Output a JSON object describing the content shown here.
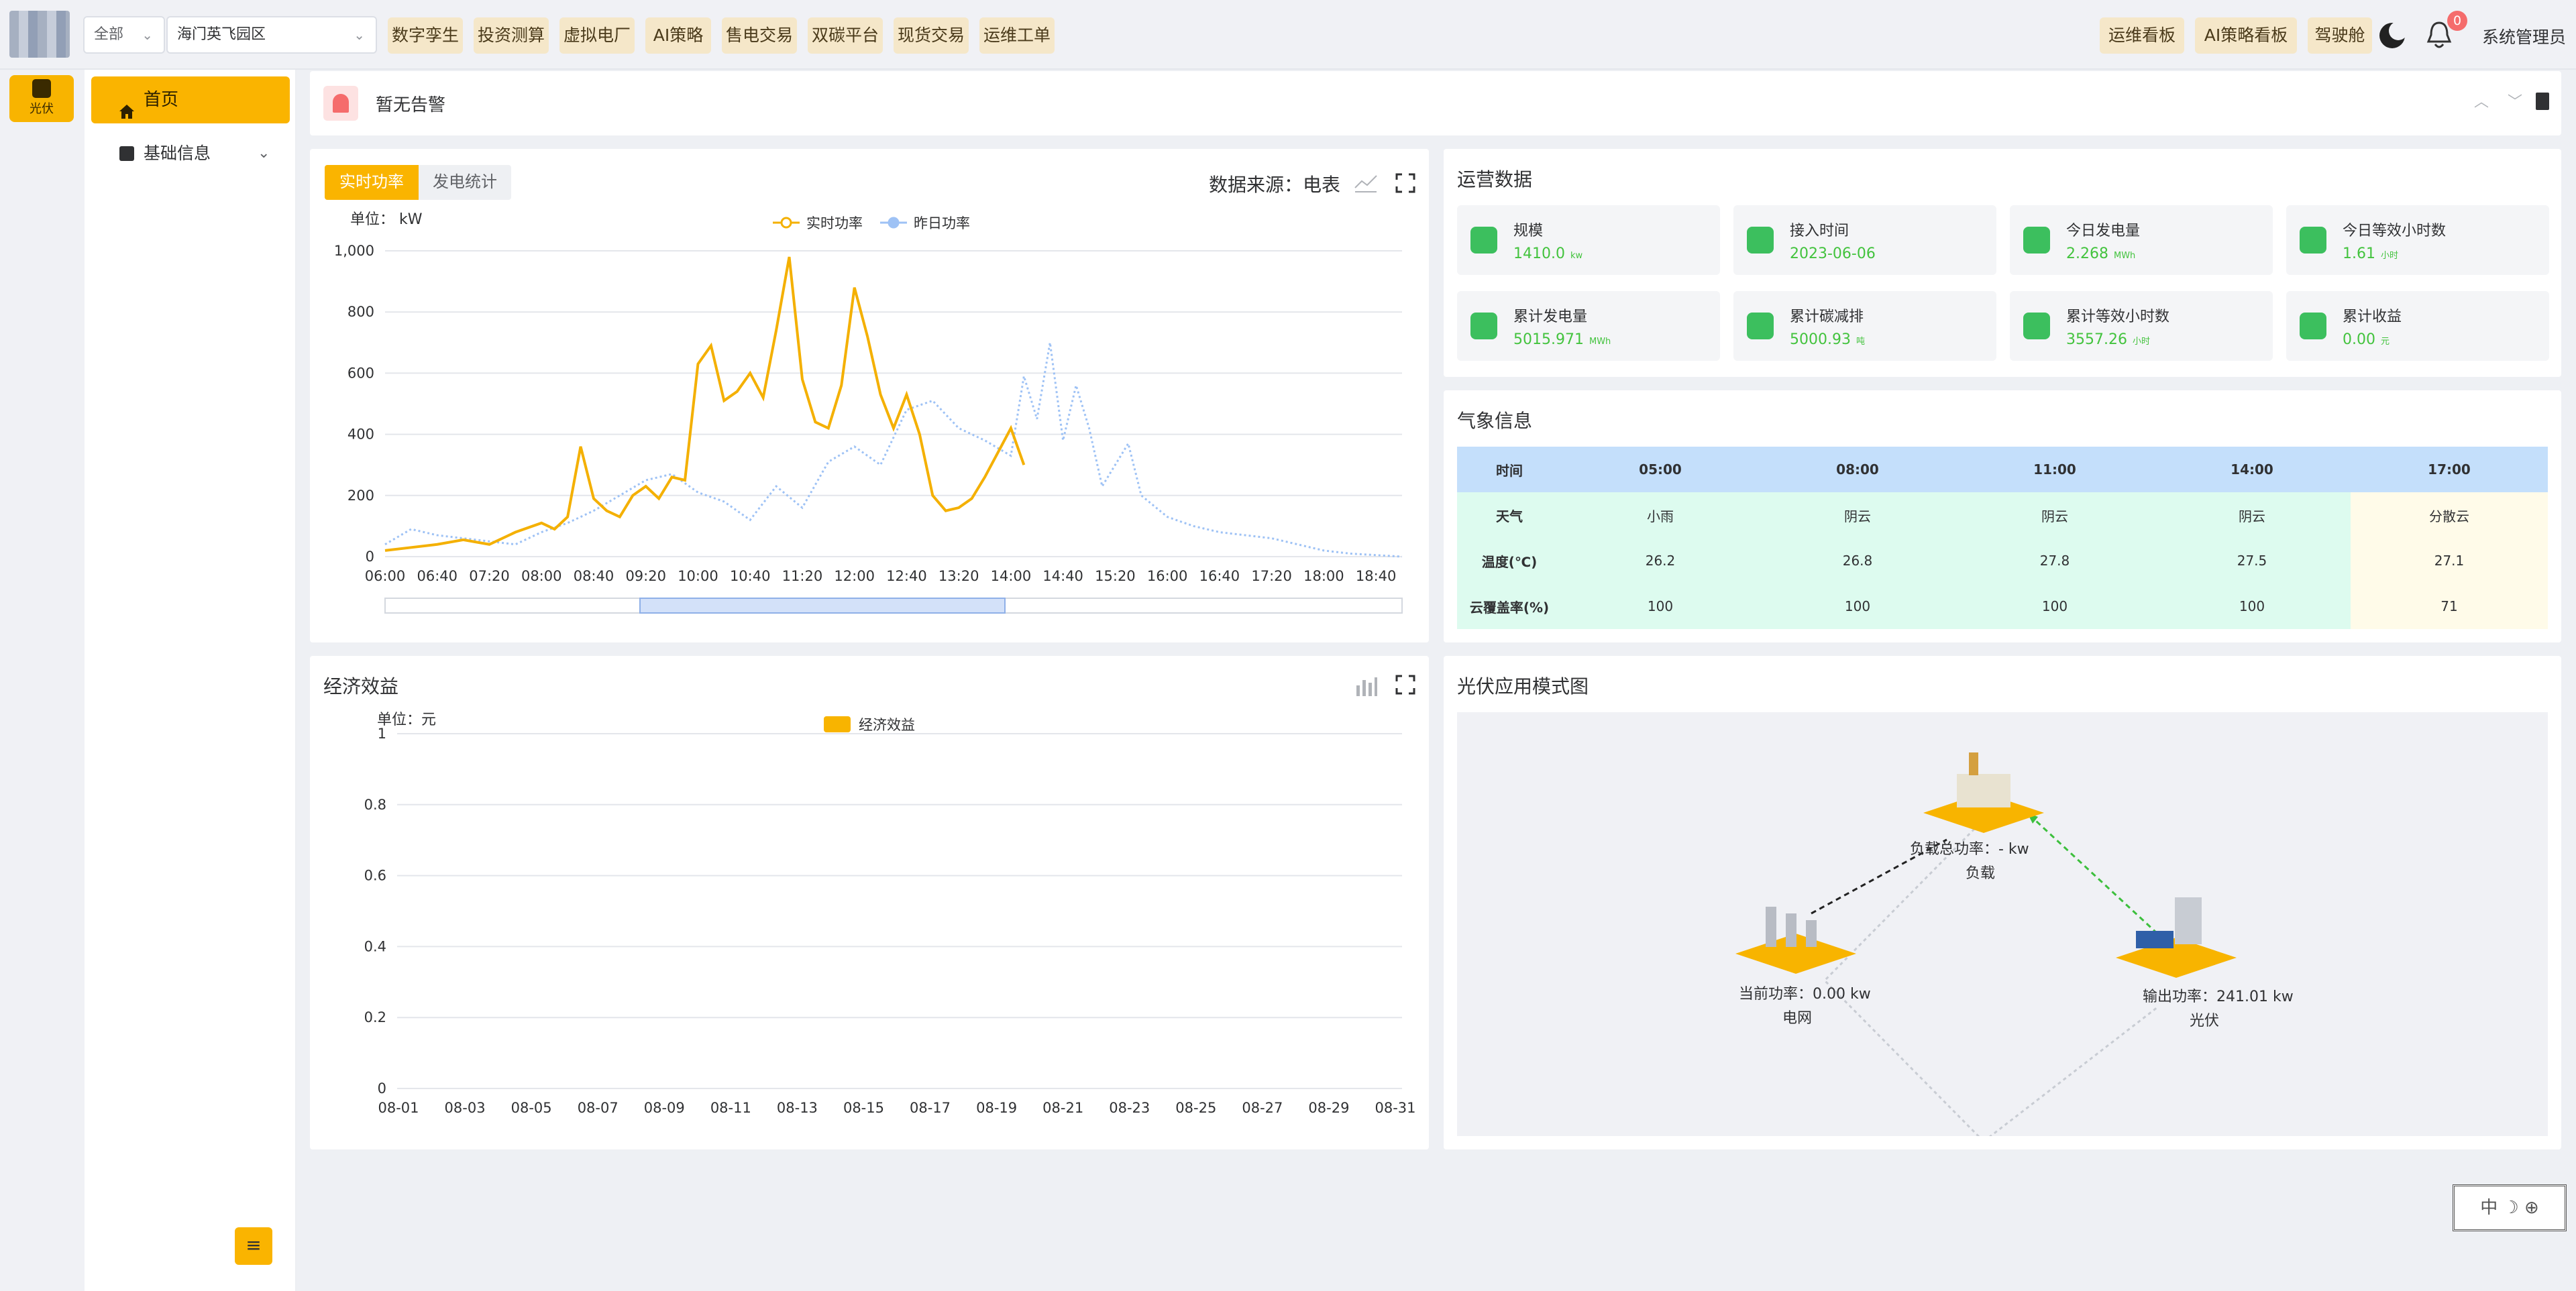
{
  "topbar": {
    "scope_select": "全部",
    "park_select": "海门英飞园区",
    "nav": [
      "数字孪生",
      "投资测算",
      "虚拟电厂",
      "AI策略",
      "售电交易",
      "双碳平台",
      "现货交易",
      "运维工单"
    ],
    "right_nav": [
      "运维看板",
      "AI策略看板",
      "驾驶舱"
    ],
    "notification_count": "0",
    "user": "系统管理员"
  },
  "rail": {
    "pv_label": "光伏"
  },
  "menu": {
    "home": "首页",
    "basic": "基础信息"
  },
  "alarm": {
    "text": "暂无告警"
  },
  "power_card": {
    "tab_active": "实时功率",
    "tab_other": "发电统计",
    "source_label": "数据来源：",
    "source_value": "电表",
    "unit": "单位： kW"
  },
  "chart_data": [
    {
      "type": "line",
      "title": "",
      "ylabel": "单位： kW",
      "ylim": [
        0,
        1000
      ],
      "yticks": [
        "0",
        "200",
        "400",
        "600",
        "800",
        "1,000"
      ],
      "x_ticks": [
        "06:00",
        "06:40",
        "07:20",
        "08:00",
        "08:40",
        "09:20",
        "10:00",
        "10:40",
        "11:20",
        "12:00",
        "12:40",
        "13:20",
        "14:00",
        "14:40",
        "15:20",
        "16:00",
        "16:40",
        "17:20",
        "18:00",
        "18:40"
      ],
      "legend_position": "top",
      "series": [
        {
          "name": "实时功率",
          "color": "#f4b000",
          "style": "solid",
          "x": [
            "06:00",
            "06:20",
            "06:40",
            "07:00",
            "07:20",
            "07:40",
            "08:00",
            "08:10",
            "08:20",
            "08:30",
            "08:40",
            "08:50",
            "09:00",
            "09:10",
            "09:20",
            "09:30",
            "09:40",
            "09:50",
            "10:00",
            "10:10",
            "10:20",
            "10:30",
            "10:40",
            "10:50",
            "11:00",
            "11:10",
            "11:20",
            "11:30",
            "11:40",
            "11:50",
            "12:00",
            "12:10",
            "12:20",
            "12:30",
            "12:40",
            "12:50",
            "13:00",
            "13:10",
            "13:20",
            "13:30",
            "13:40",
            "13:50",
            "14:00",
            "14:10"
          ],
          "values": [
            20,
            30,
            40,
            55,
            40,
            80,
            110,
            90,
            130,
            360,
            190,
            150,
            130,
            200,
            230,
            190,
            260,
            250,
            630,
            690,
            510,
            540,
            600,
            520,
            740,
            980,
            580,
            440,
            420,
            560,
            880,
            720,
            530,
            420,
            530,
            400,
            200,
            150,
            160,
            190,
            260,
            340,
            420,
            300
          ]
        },
        {
          "name": "昨日功率",
          "color": "#9ec2f5",
          "style": "dotted",
          "x": [
            "06:00",
            "06:20",
            "06:40",
            "07:00",
            "07:20",
            "07:40",
            "08:00",
            "08:20",
            "08:40",
            "09:00",
            "09:20",
            "09:40",
            "10:00",
            "10:20",
            "10:40",
            "11:00",
            "11:20",
            "11:40",
            "12:00",
            "12:20",
            "12:40",
            "13:00",
            "13:20",
            "13:40",
            "14:00",
            "14:10",
            "14:20",
            "14:30",
            "14:40",
            "14:50",
            "15:00",
            "15:10",
            "15:20",
            "15:30",
            "15:40",
            "16:00",
            "16:20",
            "16:40",
            "17:00",
            "17:20",
            "17:40",
            "18:00",
            "18:20",
            "18:40",
            "19:00"
          ],
          "values": [
            40,
            90,
            70,
            60,
            50,
            40,
            80,
            110,
            150,
            200,
            250,
            270,
            210,
            180,
            120,
            230,
            160,
            310,
            360,
            300,
            480,
            510,
            420,
            380,
            330,
            590,
            450,
            700,
            380,
            560,
            420,
            230,
            300,
            370,
            200,
            130,
            100,
            80,
            70,
            60,
            40,
            20,
            10,
            5,
            0
          ]
        }
      ]
    },
    {
      "type": "bar",
      "title": "",
      "ylabel": "单位：元",
      "ylim": [
        0,
        1
      ],
      "yticks": [
        "0",
        "0.2",
        "0.4",
        "0.6",
        "0.8",
        "1"
      ],
      "categories": [
        "08-01",
        "08-03",
        "08-05",
        "08-07",
        "08-09",
        "08-11",
        "08-13",
        "08-15",
        "08-17",
        "08-19",
        "08-21",
        "08-23",
        "08-25",
        "08-27",
        "08-29",
        "08-31"
      ],
      "legend_position": "top",
      "series": [
        {
          "name": "经济效益",
          "color": "#f8b400",
          "values": []
        }
      ]
    }
  ],
  "ops": {
    "title": "运营数据",
    "stats": [
      {
        "label": "规模",
        "value": "1410.0",
        "unit": "kw"
      },
      {
        "label": "接入时间",
        "value": "2023-06-06",
        "unit": ""
      },
      {
        "label": "今日发电量",
        "value": "2.268",
        "unit": "MWh"
      },
      {
        "label": "今日等效小时数",
        "value": "1.61",
        "unit": "小时"
      },
      {
        "label": "累计发电量",
        "value": "5015.971",
        "unit": "MWh"
      },
      {
        "label": "累计碳减排",
        "value": "5000.93",
        "unit": "吨"
      },
      {
        "label": "累计等效小时数",
        "value": "3557.26",
        "unit": "小时"
      },
      {
        "label": "累计收益",
        "value": "0.00",
        "unit": "元"
      }
    ]
  },
  "weather": {
    "title": "气象信息",
    "header": [
      "时间",
      "05:00",
      "08:00",
      "11:00",
      "14:00",
      "17:00"
    ],
    "rows": [
      [
        "天气",
        "小雨",
        "阴云",
        "阴云",
        "阴云",
        "分散云"
      ],
      [
        "温度(℃)",
        "26.2",
        "26.8",
        "27.8",
        "27.5",
        "27.1"
      ],
      [
        "云覆盖率(%)",
        "100",
        "100",
        "100",
        "100",
        "71"
      ]
    ]
  },
  "econ": {
    "title": "经济效益",
    "unit": "单位：元",
    "legend": "经济效益"
  },
  "pv_mode": {
    "title": "光伏应用模式图",
    "load_power": "负载总功率：- kw",
    "load_name": "负载",
    "grid_power": "当前功率：0.00 kw",
    "grid_name": "电网",
    "pv_power": "输出功率：241.01 kw",
    "pv_name": "光伏"
  },
  "lang_badge": "中 ☽ ⊕"
}
